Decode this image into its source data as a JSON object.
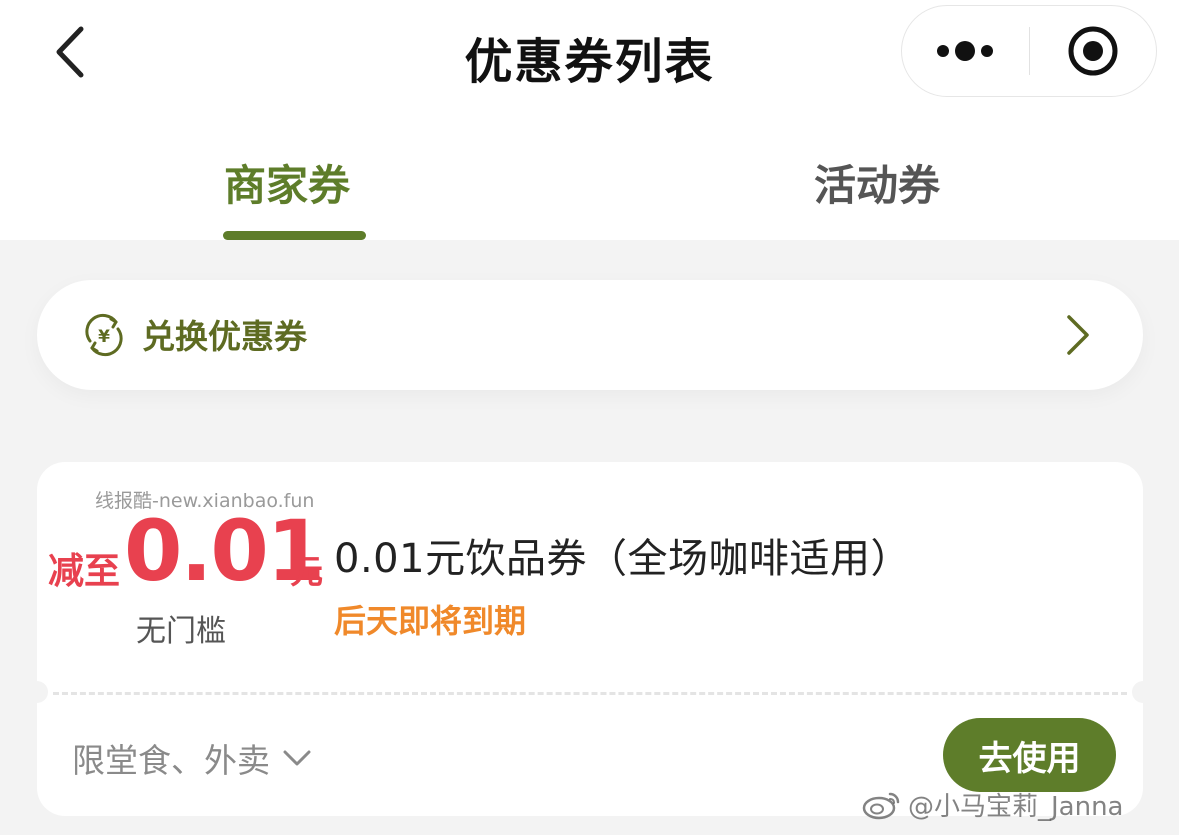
{
  "header": {
    "title": "优惠券列表",
    "back_icon": "chevron-left-icon",
    "more_icon": "more-dots-icon",
    "close_icon": "record-close-icon"
  },
  "tabs": [
    {
      "label": "商家券",
      "active": true
    },
    {
      "label": "活动券",
      "active": false
    }
  ],
  "redeem": {
    "label": "兑换优惠券",
    "icon": "yuan-exchange-icon",
    "chevron_icon": "chevron-right-icon"
  },
  "coupon": {
    "watermark": "线报酷-new.xianbao.fun",
    "prefix": "减至",
    "amount": "0.01",
    "unit": "元",
    "threshold": "无门槛",
    "name": "0.01元饮品券（全场咖啡适用）",
    "expire": "后天即将到期",
    "scope": "限堂食、外卖",
    "use_button": "去使用"
  },
  "footer_watermark": "@小马宝莉_Janna",
  "colors": {
    "accent_green": "#5e7d2a",
    "price_red": "#e8414f",
    "expire_orange": "#f0892a"
  }
}
